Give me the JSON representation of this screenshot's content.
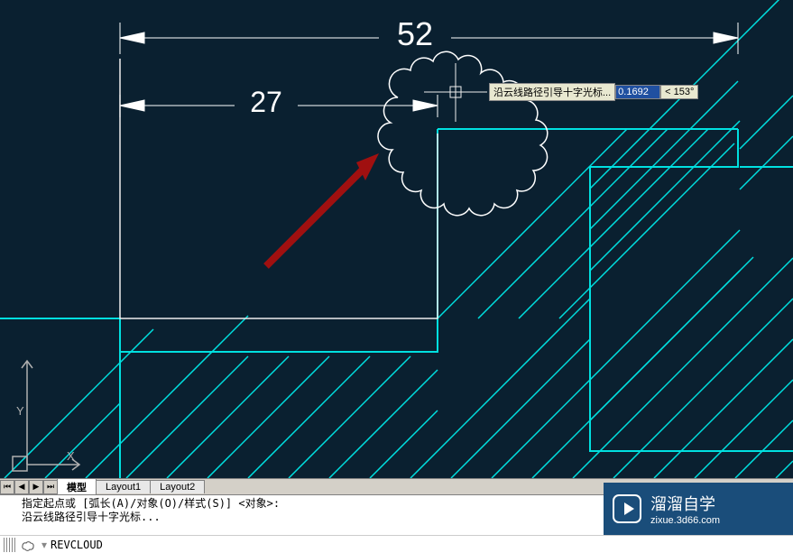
{
  "dimensions": {
    "dim1": "52",
    "dim2": "27"
  },
  "tooltip": {
    "label": "沿云线路径引导十字光标...",
    "value": "0.1692",
    "angle": "< 153°"
  },
  "tabs": {
    "model": "模型",
    "layout1": "Layout1",
    "layout2": "Layout2"
  },
  "command": {
    "history1": "指定起点或  [弧长(A)/对象(O)/样式(S)]  <对象>:",
    "history2": "沿云线路径引导十字光标...",
    "prompt": "REVCLOUD"
  },
  "watermark": {
    "brand": "溜溜自学",
    "url": "zixue.3d66.com"
  },
  "axis": {
    "x": "X",
    "y": "Y"
  },
  "colors": {
    "bg": "#0a2030",
    "cyan": "#00ffff",
    "white": "#ffffff",
    "red": "#cc0000",
    "panel": "#d4d0c8"
  }
}
